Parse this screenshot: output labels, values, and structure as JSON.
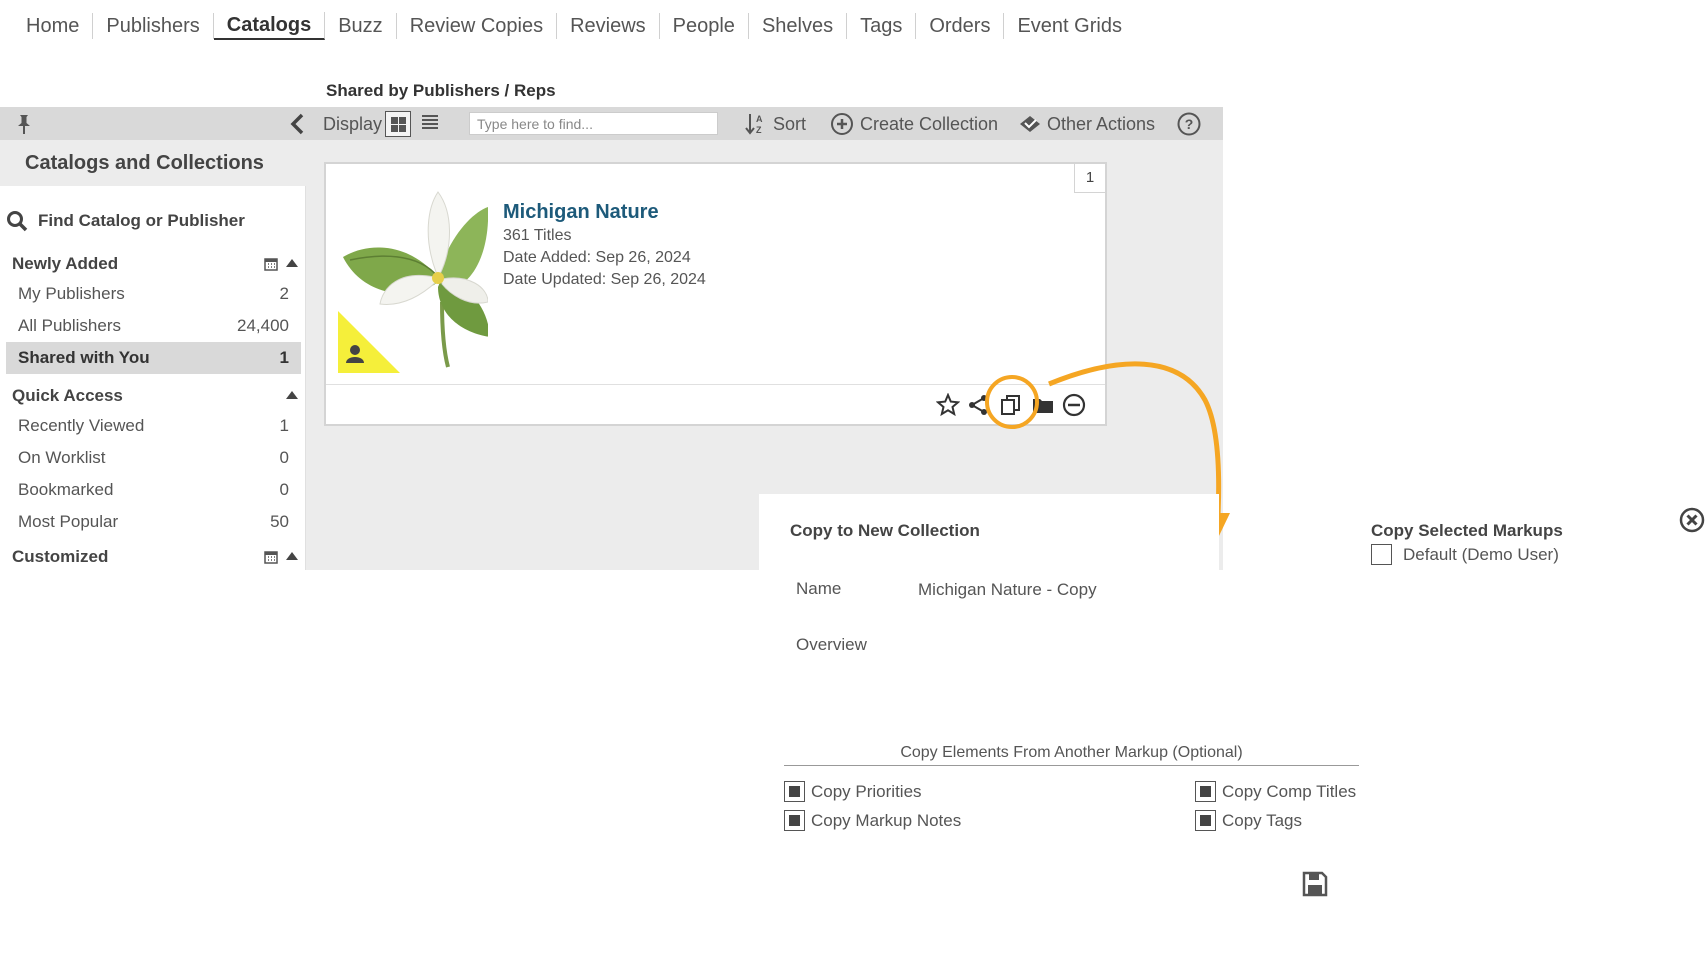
{
  "nav": {
    "items": [
      "Home",
      "Publishers",
      "Catalogs",
      "Buzz",
      "Review Copies",
      "Reviews",
      "People",
      "Shelves",
      "Tags",
      "Orders",
      "Event Grids"
    ],
    "active_index": 2
  },
  "section_title": "Shared by Publishers / Reps",
  "toolbar": {
    "display_label": "Display",
    "find_placeholder": "Type here to find...",
    "sort_label": "Sort",
    "create_label": "Create Collection",
    "other_actions_label": "Other Actions"
  },
  "sidebar": {
    "title": "Catalogs and Collections",
    "find_label": "Find Catalog or Publisher",
    "groups": {
      "newly_added": {
        "label": "Newly Added",
        "items": [
          {
            "label": "My Publishers",
            "count": "2"
          },
          {
            "label": "All Publishers",
            "count": "24,400"
          },
          {
            "label": "Shared with You",
            "count": "1"
          }
        ]
      },
      "quick_access": {
        "label": "Quick Access",
        "items": [
          {
            "label": "Recently Viewed",
            "count": "1"
          },
          {
            "label": "On Worklist",
            "count": "0"
          },
          {
            "label": "Bookmarked",
            "count": "0"
          },
          {
            "label": "Most Popular",
            "count": "50"
          }
        ]
      },
      "customized": {
        "label": "Customized"
      }
    }
  },
  "card": {
    "number": "1",
    "title": "Michigan Nature",
    "titles_count": "361 Titles",
    "date_added": "Date Added: Sep 26, 2024",
    "date_updated": "Date Updated: Sep 26, 2024"
  },
  "copy_panel": {
    "title": "Copy to New Collection",
    "name_label": "Name",
    "name_value": "Michigan Nature - Copy",
    "overview_label": "Overview",
    "optional_title": "Copy Elements From Another Markup (Optional)",
    "options": {
      "priorities": "Copy Priorities",
      "comp_titles": "Copy Comp Titles",
      "markup_notes": "Copy Markup Notes",
      "tags": "Copy Tags"
    }
  },
  "markups": {
    "title": "Copy Selected Markups",
    "default_option": "Default (Demo User)"
  },
  "colors": {
    "accent_orange": "#f5a623",
    "title_blue": "#1d5a7a",
    "badge_yellow": "#f5ef3a"
  }
}
